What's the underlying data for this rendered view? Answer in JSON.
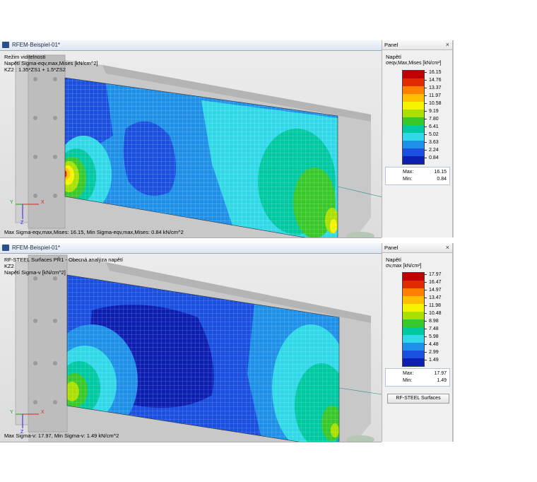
{
  "windows": [
    {
      "title": "RFEM-Beispiel-01*",
      "info_lines": [
        "Režim viditelnosti",
        "Napětí Sigma-eqv,max,Mises [kN/cm^2]",
        "KZ2 : 1.35*ZS1 + 1.5*ZS2"
      ],
      "bottom_text": "Max Sigma-eqv,max,Mises: 16.15, Min Sigma-eqv,max,Mises: 0.84 kN/cm^2",
      "panel": {
        "header": "Panel",
        "title": "Napětí",
        "subtitle": "σeqv,Max,Mises [kN/cm²]",
        "legend_values": [
          "16.15",
          "14.76",
          "13.37",
          "11.97",
          "10.58",
          "9.19",
          "7.80",
          "6.41",
          "5.02",
          "3.63",
          "2.24",
          "0.84"
        ],
        "max_label": "Max:",
        "max_value": "16.15",
        "min_label": "Min:",
        "min_value": "0.84"
      },
      "axes": {
        "y": "Y",
        "x": "X",
        "z": "Z"
      }
    },
    {
      "title": "RFEM-Beispiel-01*",
      "info_lines": [
        "RF-STEEL Surfaces PŘ1 - Obecná analýza napětí",
        "KZ2",
        "Napětí Sigma-v [kN/cm^2]"
      ],
      "bottom_text": "Max Sigma-v: 17.97, Min Sigma-v: 1.49 kN/cm^2",
      "panel": {
        "header": "Panel",
        "title": "Napětí",
        "subtitle": "σv,max [kN/cm²]",
        "legend_values": [
          "17.97",
          "16.47",
          "14.97",
          "13.47",
          "11.98",
          "10.48",
          "8.98",
          "7.48",
          "5.98",
          "4.48",
          "2.99",
          "1.49"
        ],
        "max_label": "Max:",
        "max_value": "17.97",
        "min_label": "Min:",
        "min_value": "1.49",
        "button_label": "RF-STEEL Surfaces"
      },
      "axes": {
        "y": "Y",
        "x": "X",
        "z": "Z"
      }
    }
  ],
  "colors": {
    "scale": [
      "#c00000",
      "#e02a00",
      "#ff7f00",
      "#ffbf00",
      "#f3f300",
      "#a9e000",
      "#39c82a",
      "#00c8a0",
      "#30d8e8",
      "#1e90e8",
      "#1a4fe0",
      "#0d1fb0"
    ],
    "plate_base": "#2a9ae6",
    "mesh": "#ffffff"
  },
  "icons": {
    "window_icon": "rfem-app-icon",
    "close": "close-icon"
  }
}
